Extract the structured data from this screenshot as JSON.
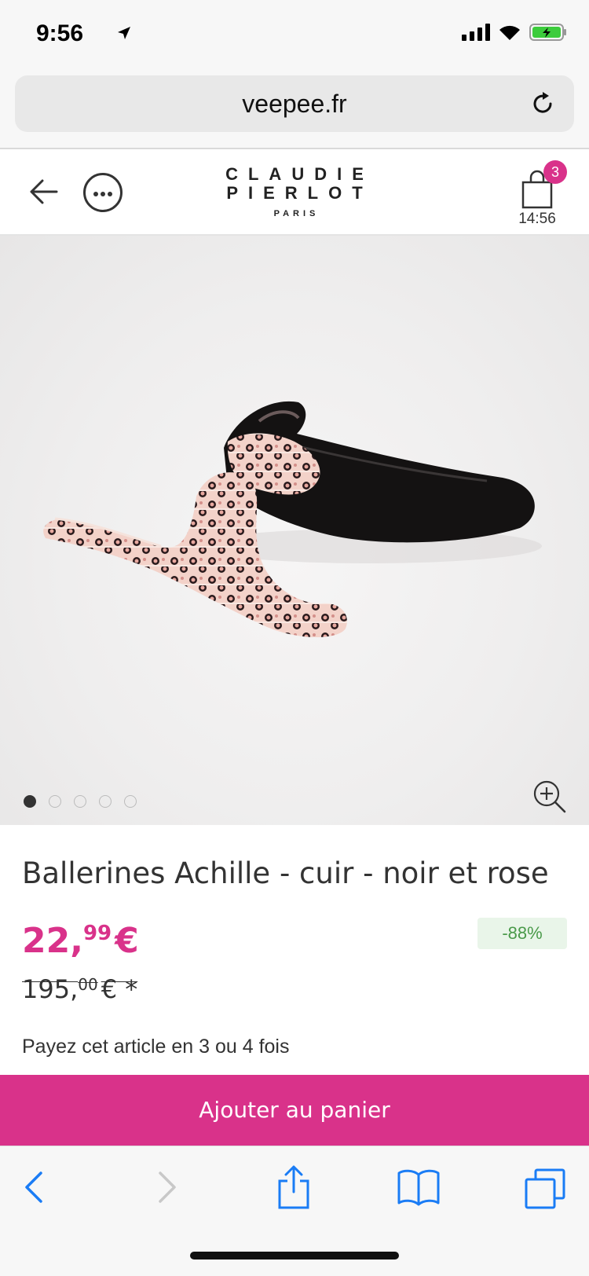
{
  "status_bar": {
    "time": "9:56"
  },
  "browser": {
    "url": "veepee.fr"
  },
  "header": {
    "logo_line1": "CLAUDIE",
    "logo_line2": "PIERLOT",
    "logo_line3": "PARIS",
    "cart_count": "3",
    "cart_timer": "14:56"
  },
  "gallery": {
    "total_images": 5,
    "active_index": 0
  },
  "product": {
    "title": "Ballerines Achille - cuir - noir et rose",
    "price_int": "22,",
    "price_dec": "99",
    "price_currency": "€",
    "old_price_int": "195,",
    "old_price_dec": "00",
    "old_price_currency": "€ *",
    "discount": "-88%",
    "installments": "Payez cet article en 3 ou 4 fois"
  },
  "actions": {
    "add_to_cart": "Ajouter au panier"
  },
  "colors": {
    "accent": "#d9328a",
    "discount_bg": "#e9f5e9",
    "discount_text": "#4a9a4a"
  }
}
